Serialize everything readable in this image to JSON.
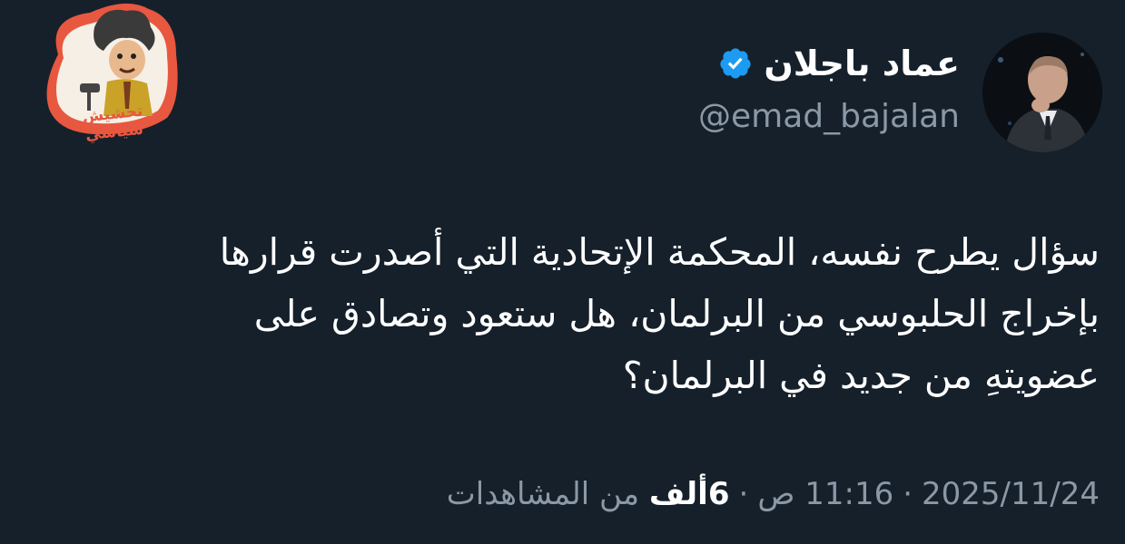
{
  "author": {
    "display_name": "عماد باجلان",
    "handle": "@emad_bajalan",
    "verified_icon": "verified-badge-icon",
    "verified_color": "#1d9bf0"
  },
  "sticker": {
    "text": "تحشيش سياسي",
    "color": "#e8573f"
  },
  "tweet": {
    "text_lines": [
      "سؤال يطرح نفسه، المحكمة الإتحادية التي أصدرت قرارها",
      "بإخراج الحلبوسي من البرلمان، هل ستعود وتصادق على",
      "عضويتهِ من جديد في البرلمان؟"
    ]
  },
  "meta": {
    "date": "2025/11/24",
    "separator": "·",
    "time": "11:16 ص",
    "views_count": "6ألف",
    "views_label": "من المشاهدات"
  },
  "theme": {
    "background": "#15202b",
    "text": "#ffffff",
    "muted": "#8b98a5"
  }
}
